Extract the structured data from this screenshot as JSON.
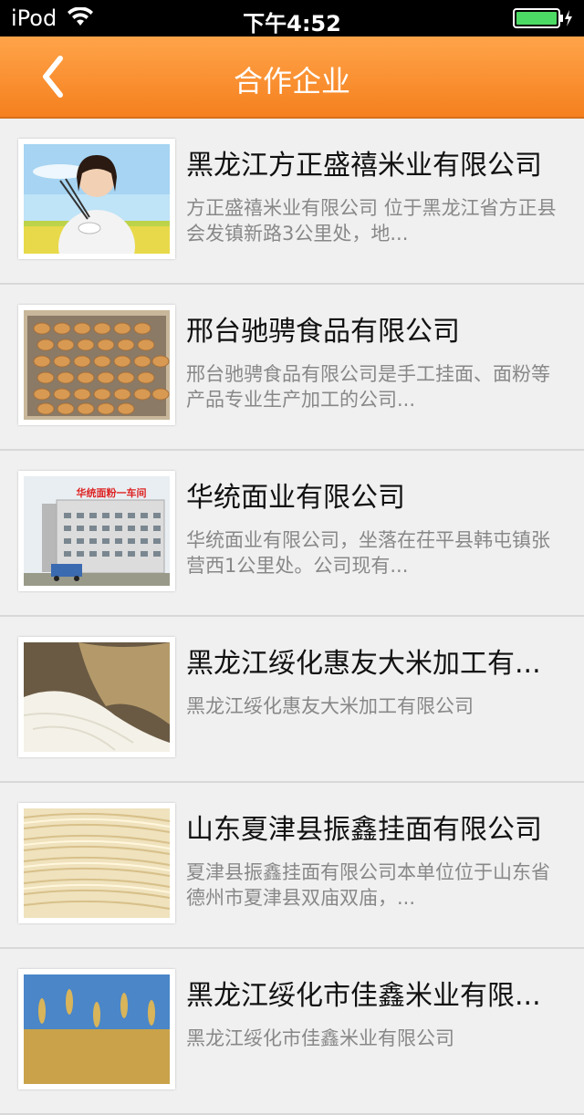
{
  "status_bar": {
    "carrier": "iPod",
    "time": "下午4:52"
  },
  "nav": {
    "title": "合作企业"
  },
  "companies": [
    {
      "title": "黑龙江方正盛禧米业有限公司",
      "desc": "方正盛禧米业有限公司 位于黑龙江省方正县会发镇新路3公里处，地..."
    },
    {
      "title": "邢台驰骋食品有限公司",
      "desc": "邢台驰骋食品有限公司是手工挂面、面粉等产品专业生产加工的公司..."
    },
    {
      "title": "华统面业有限公司",
      "desc": "华统面业有限公司，坐落在茌平县韩屯镇张营西1公里处。公司现有...",
      "image_sign": "华统面粉一车间"
    },
    {
      "title": "黑龙江绥化惠友大米加工有...",
      "desc": "黑龙江绥化惠友大米加工有限公司"
    },
    {
      "title": "山东夏津县振鑫挂面有限公司",
      "desc": "夏津县振鑫挂面有限公司本单位位于山东省德州市夏津县双庙双庙，..."
    },
    {
      "title": "黑龙江绥化市佳鑫米业有限...",
      "desc": "黑龙江绥化市佳鑫米业有限公司"
    }
  ]
}
